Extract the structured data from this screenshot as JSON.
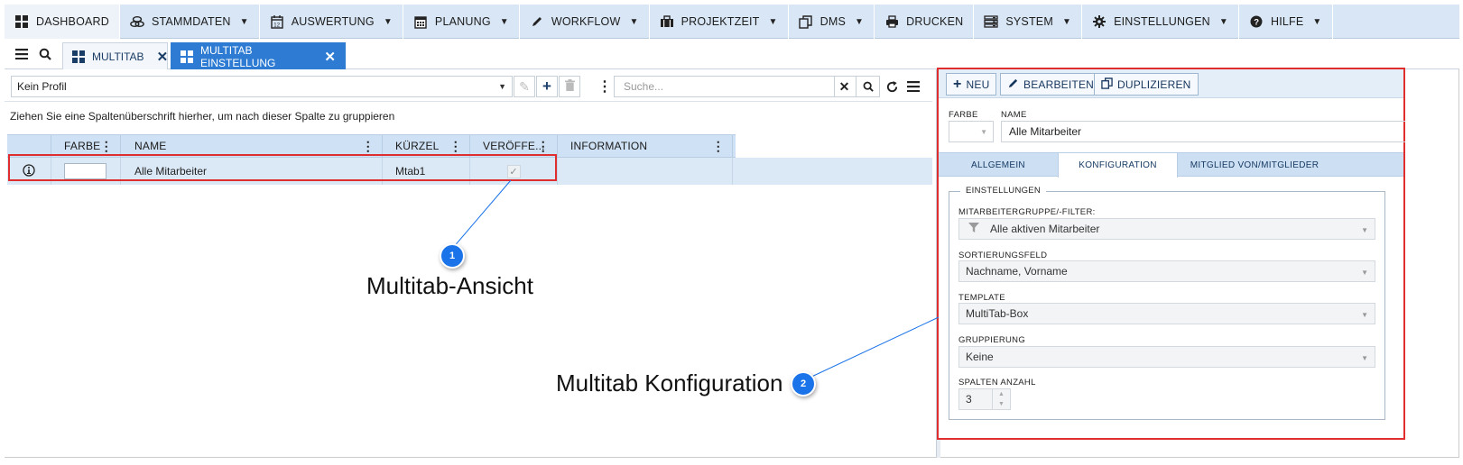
{
  "menu": [
    {
      "icon": "dashboard-icon",
      "label": "DASHBOARD",
      "caret": false,
      "active": true
    },
    {
      "icon": "coins-icon",
      "label": "STAMMDATEN",
      "caret": true
    },
    {
      "icon": "calendar-12-icon",
      "label": "AUSWERTUNG",
      "caret": true
    },
    {
      "icon": "calendar-icon",
      "label": "PLANUNG",
      "caret": true
    },
    {
      "icon": "pencil-icon",
      "label": "WORKFLOW",
      "caret": true
    },
    {
      "icon": "briefcase-icon",
      "label": "PROJEKTZEIT",
      "caret": true
    },
    {
      "icon": "documents-icon",
      "label": "DMS",
      "caret": true
    },
    {
      "icon": "printer-icon",
      "label": "DRUCKEN",
      "caret": false
    },
    {
      "icon": "server-icon",
      "label": "SYSTEM",
      "caret": true
    },
    {
      "icon": "gear-icon",
      "label": "EINSTELLUNGEN",
      "caret": true
    },
    {
      "icon": "help-icon",
      "label": "HILFE",
      "caret": true
    }
  ],
  "tabs": [
    {
      "label": "MULTITAB",
      "active": false
    },
    {
      "label": "MULTITAB EINSTELLUNG",
      "active": true
    }
  ],
  "toolbar": {
    "profile": "Kein Profil",
    "search_placeholder": "Suche..."
  },
  "grid": {
    "group_hint": "Ziehen Sie eine Spaltenüberschrift hierher, um nach dieser Spalte zu gruppieren",
    "columns": [
      "FARBE",
      "NAME",
      "KÜRZEL",
      "VERÖFFE...",
      "INFORMATION"
    ],
    "rows": [
      {
        "name": "Alle Mitarbeiter",
        "kuerzel": "Mtab1",
        "published": true
      }
    ]
  },
  "detail": {
    "buttons": {
      "new": "NEU",
      "edit": "BEARBEITEN",
      "duplicate": "DUPLIZIEREN"
    },
    "farbe_label": "FARBE",
    "name_label": "NAME",
    "name_value": "Alle Mitarbeiter",
    "tabs": [
      "ALLGEMEIN",
      "KONFIGURATION",
      "MITGLIED VON/MITGLIEDER"
    ],
    "active_tab": "KONFIGURATION",
    "settings": {
      "legend": "EINSTELLUNGEN",
      "group_filter_label": "MITARBEITERGRUPPE/-FILTER:",
      "group_filter_value": "Alle aktiven Mitarbeiter",
      "sort_label": "SORTIERUNGSFELD",
      "sort_value": "Nachname, Vorname",
      "template_label": "TEMPLATE",
      "template_value": "MultiTab-Box",
      "grouping_label": "GRUPPIERUNG",
      "grouping_value": "Keine",
      "columns_label": "SPALTEN ANZAHL",
      "columns_value": "3"
    }
  },
  "callouts": [
    {
      "number": "1",
      "label": "Multitab-Ansicht"
    },
    {
      "number": "2",
      "label": "Multitab Konfiguration"
    }
  ],
  "colors": {
    "accent": "#2d7bd2",
    "highlight": "#e02d2d",
    "badge": "#1a73e8",
    "menubar": "#d8e6f5"
  }
}
